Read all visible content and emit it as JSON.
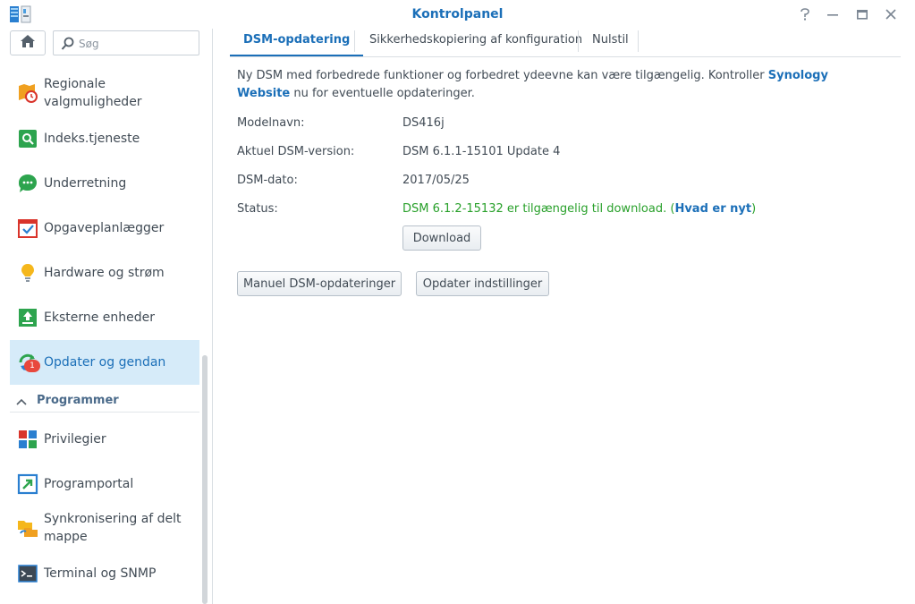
{
  "window": {
    "title": "Kontrolpanel",
    "icon": "control-panel-icon"
  },
  "sidebar": {
    "search_placeholder": "Søg",
    "items": [
      {
        "label_line1": "Regionale",
        "label_line2": "valgmuligheder",
        "icon": "regional-clock-icon"
      },
      {
        "label": "Indeks.tjeneste",
        "icon": "index-search-icon"
      },
      {
        "label": "Underretning",
        "icon": "chat-bubble-icon"
      },
      {
        "label": "Opgaveplanlægger",
        "icon": "calendar-check-icon"
      },
      {
        "label": "Hardware og strøm",
        "icon": "lightbulb-icon"
      },
      {
        "label": "Eksterne enheder",
        "icon": "upload-icon"
      },
      {
        "label": "Opdater og gendan",
        "icon": "update-restore-icon",
        "badge": "1",
        "active": true
      }
    ],
    "section": {
      "label": "Programmer"
    },
    "section_items": [
      {
        "label": "Privilegier",
        "icon": "privileges-grid-icon"
      },
      {
        "label": "Programportal",
        "icon": "portal-arrow-icon"
      },
      {
        "label_line1": "Synkronisering af delt",
        "label_line2": "mappe",
        "icon": "sync-folder-icon"
      },
      {
        "label": "Terminal og SNMP",
        "icon": "terminal-icon"
      }
    ]
  },
  "tabs": [
    {
      "label": "DSM-opdatering",
      "active": true
    },
    {
      "label": "Sikkerhedskopiering af konfiguration",
      "active": false
    },
    {
      "label": "Nulstil",
      "active": false
    }
  ],
  "content": {
    "intro_part1": "Ny DSM med forbedrede funktioner og forbedret ydeevne kan være tilgængelig. Kontroller ",
    "intro_link": "Synology Website",
    "intro_part2": " nu for eventuelle opdateringer.",
    "rows": [
      {
        "key": "Modelnavn:",
        "value": "DS416j"
      },
      {
        "key": "Aktuel DSM-version:",
        "value": "DSM 6.1.1-15101 Update 4"
      },
      {
        "key": "DSM-dato:",
        "value": "2017/05/25"
      }
    ],
    "status_key": "Status:",
    "status_text": "DSM 6.1.2-15132 er tilgængelig til download. (",
    "status_link": "Hvad er nyt",
    "status_close": ")",
    "download_button": "Download",
    "manual_button": "Manuel DSM-opdateringer",
    "settings_button": "Opdater indstillinger"
  },
  "colors": {
    "accent": "#1b6fb8",
    "status_green": "#28a02a",
    "active_bg": "#d6ebf9",
    "badge": "#e8483d"
  }
}
